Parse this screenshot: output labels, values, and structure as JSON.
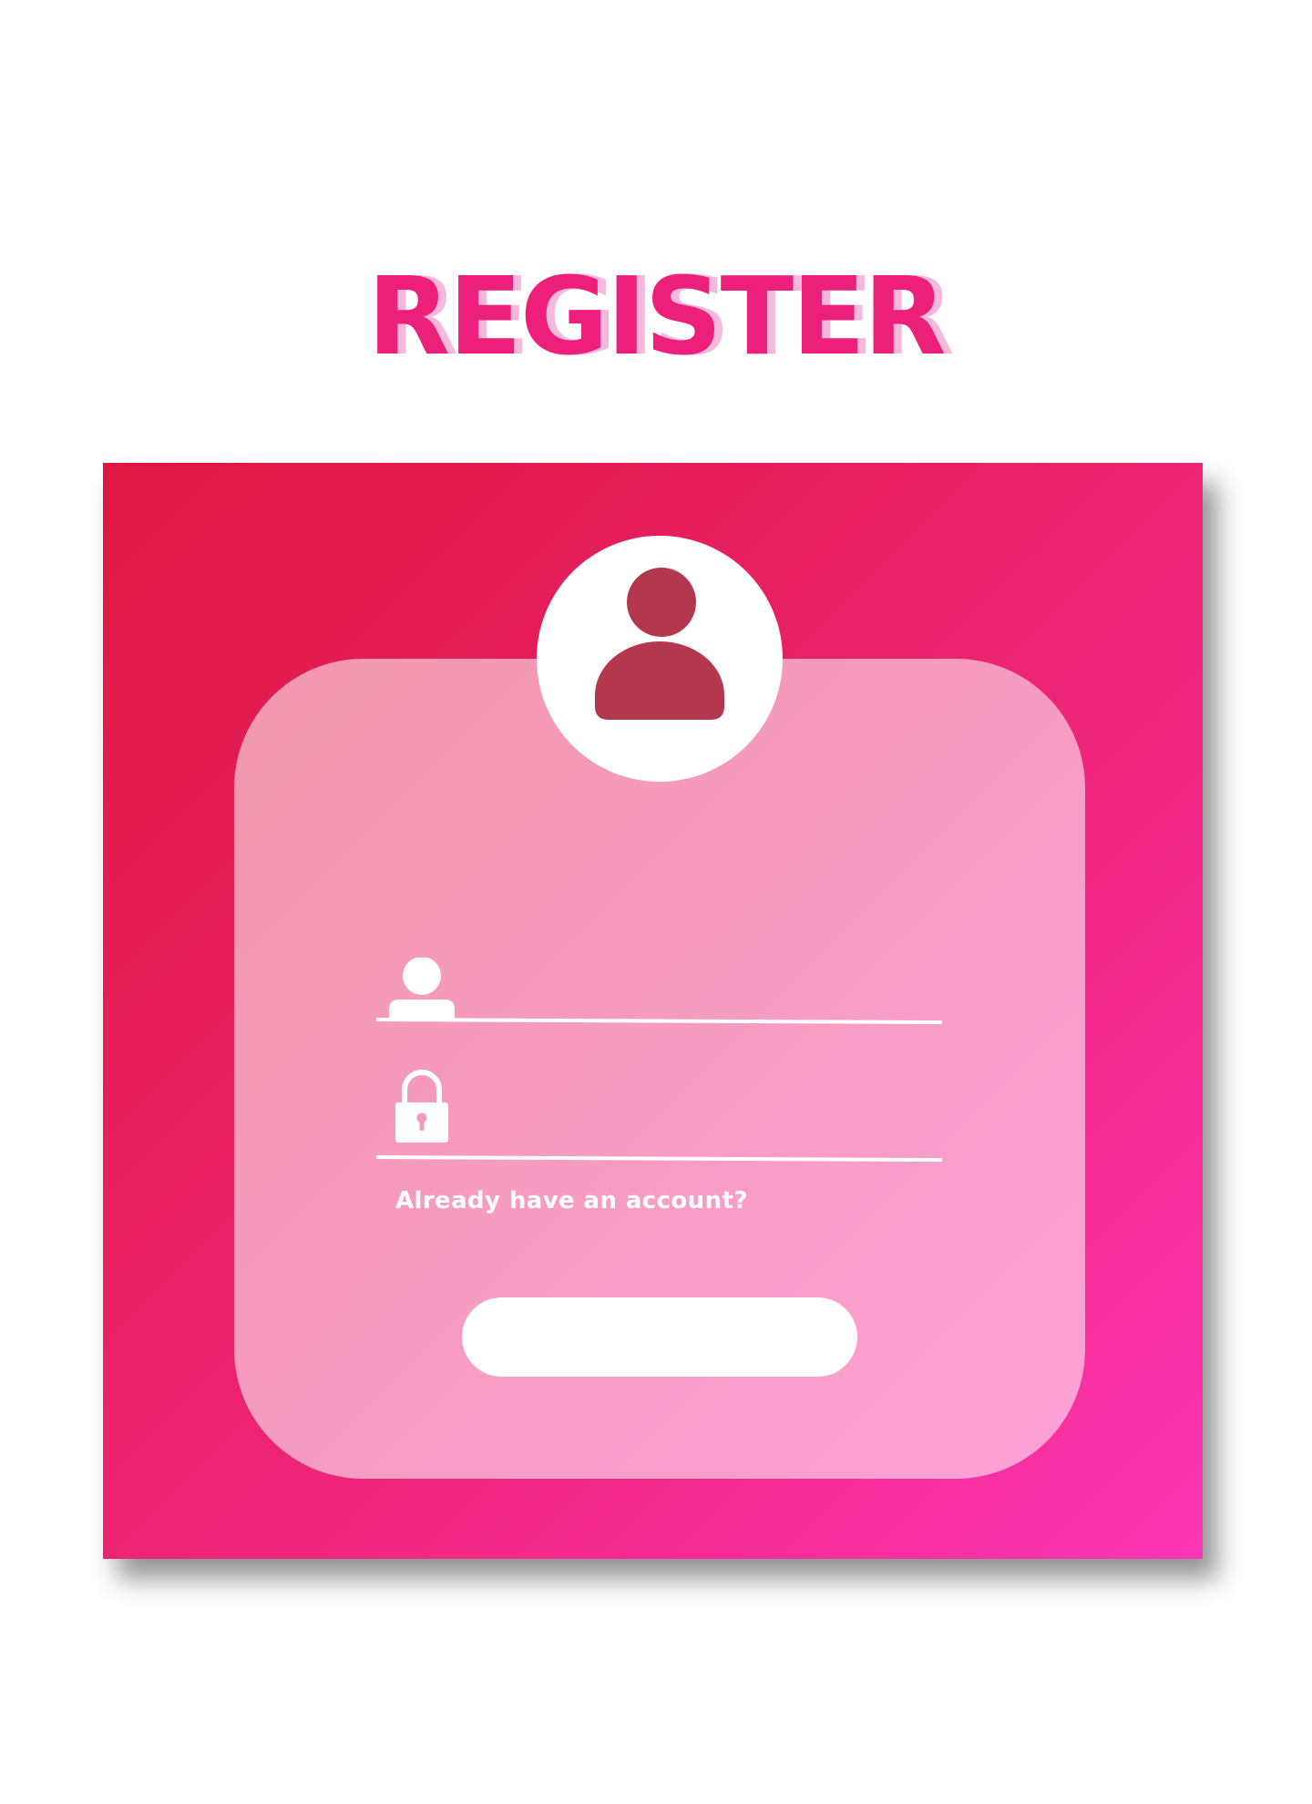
{
  "page": {
    "title": "REGISTER"
  },
  "form": {
    "username": {
      "value": "",
      "placeholder": "",
      "icon": "user-icon"
    },
    "password": {
      "value": "",
      "placeholder": "",
      "icon": "lock-icon"
    },
    "account_link": "Already have an account?",
    "submit_label": ""
  },
  "avatar": {
    "icon": "user-avatar-icon"
  },
  "colors": {
    "title": "#ec1f7a",
    "title_shadow": "#f7b8dc",
    "gradient_start": "#dd1840",
    "gradient_end": "#fc36b6",
    "avatar_figure": "#b3384d",
    "card": "rgba(255,255,255,0.55)"
  }
}
